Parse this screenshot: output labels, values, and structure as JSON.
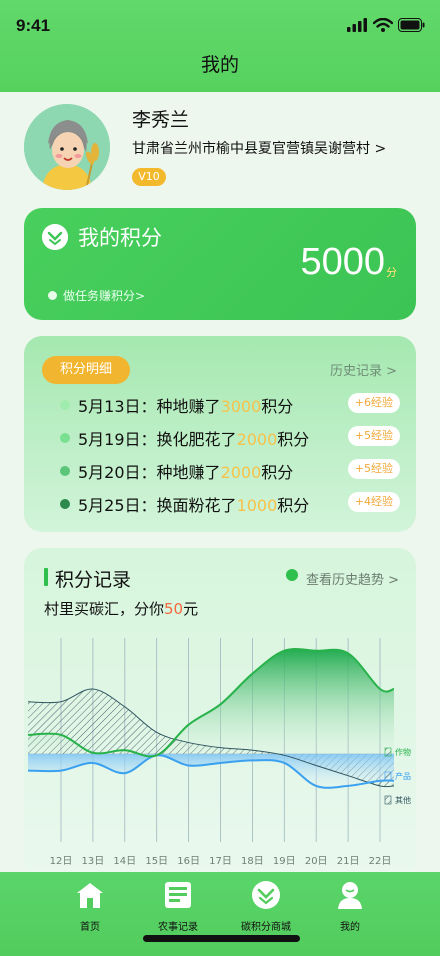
{
  "status": {
    "time": "9:41"
  },
  "header": {
    "title": "我的"
  },
  "profile": {
    "name": "李秀兰",
    "address": "甘肃省兰州市榆中县夏官营镇吴谢营村 >",
    "level": "V10"
  },
  "points": {
    "label": "我的积分",
    "value": "5000",
    "unit": "分",
    "task_link": "做任务赚积分>"
  },
  "detail": {
    "tag": "积分明细",
    "history": "历史记录 >",
    "rows": [
      {
        "date": "5月13日：",
        "action": "种地赚了",
        "amount": "3000",
        "unit": "积分",
        "exp": "+6经验",
        "dot": "#9fecae"
      },
      {
        "date": "5月19日：",
        "action": "换化肥花了",
        "amount": "2000",
        "unit": "积分",
        "exp": "+5经验",
        "dot": "#78e090"
      },
      {
        "date": "5月20日：",
        "action": "种地赚了",
        "amount": "2000",
        "unit": "积分",
        "exp": "+5经验",
        "dot": "#5bc57a"
      },
      {
        "date": "5月25日：",
        "action": "换面粉花了",
        "amount": "1000",
        "unit": "积分",
        "exp": "+4经验",
        "dot": "#2e8a4c"
      }
    ]
  },
  "record": {
    "title": "积分记录",
    "trend_link": "查看历史趋势 >",
    "subtitle_prefix": "村里买碳汇，分你",
    "subtitle_amount": "50",
    "subtitle_suffix": "元"
  },
  "chart_data": {
    "type": "area",
    "categories": [
      "12日",
      "13日",
      "14日",
      "15日",
      "16日",
      "17日",
      "18日",
      "19日",
      "20日",
      "21日",
      "22日"
    ],
    "series": [
      {
        "name": "作物",
        "color": "#27b24a",
        "values": [
          62,
          55,
          56,
          54,
          66,
          74,
          86,
          95,
          95,
          94,
          80
        ]
      },
      {
        "name": "产品",
        "color": "#3aa0f0",
        "values": [
          48,
          51,
          47,
          54,
          50,
          51,
          52,
          51,
          42,
          42,
          44
        ]
      },
      {
        "name": "其他",
        "color": "#2f5560",
        "values": [
          75,
          80,
          73,
          63,
          59,
          57,
          56,
          54,
          50,
          46,
          42
        ]
      }
    ],
    "ylim": [
      20,
      100
    ],
    "grid": true,
    "legend": "right"
  },
  "tabs": [
    {
      "label": "首页",
      "icon": "home-icon"
    },
    {
      "label": "农事记录",
      "icon": "record-icon"
    },
    {
      "label": "碳积分商城",
      "icon": "mall-icon"
    },
    {
      "label": "我的",
      "icon": "user-icon"
    }
  ]
}
